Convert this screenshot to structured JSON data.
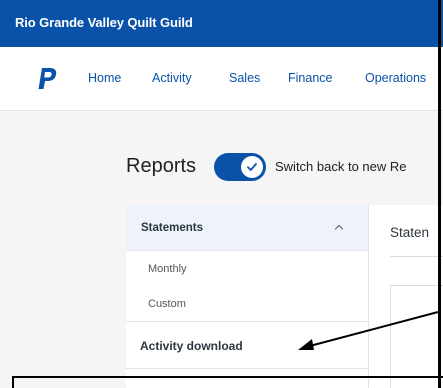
{
  "org": {
    "name": "Rio Grande Valley Quilt Guild"
  },
  "logo": {
    "icon": "paypal-logo-icon",
    "color": "#0a52a8"
  },
  "nav": {
    "items": [
      {
        "label": "Home"
      },
      {
        "label": "Activity"
      },
      {
        "label": "Sales"
      },
      {
        "label": "Finance"
      },
      {
        "label": "Operations"
      }
    ]
  },
  "page": {
    "title": "Reports",
    "toggle": {
      "on": true,
      "icon": "check-icon",
      "label": "Switch back to new Re"
    }
  },
  "sidebar": {
    "section": {
      "label": "Statements",
      "expanded": true,
      "icon": "chevron-up-icon"
    },
    "sub_items": [
      {
        "label": "Monthly"
      },
      {
        "label": "Custom"
      }
    ],
    "activity_download": {
      "label": "Activity download"
    }
  },
  "content": {
    "title": "Staten"
  },
  "annotation": {
    "arrow_color": "#000000"
  },
  "colors": {
    "brand_blue": "#0a52a8",
    "background": "#f5f5f5",
    "panel_header": "#eef3fa"
  }
}
